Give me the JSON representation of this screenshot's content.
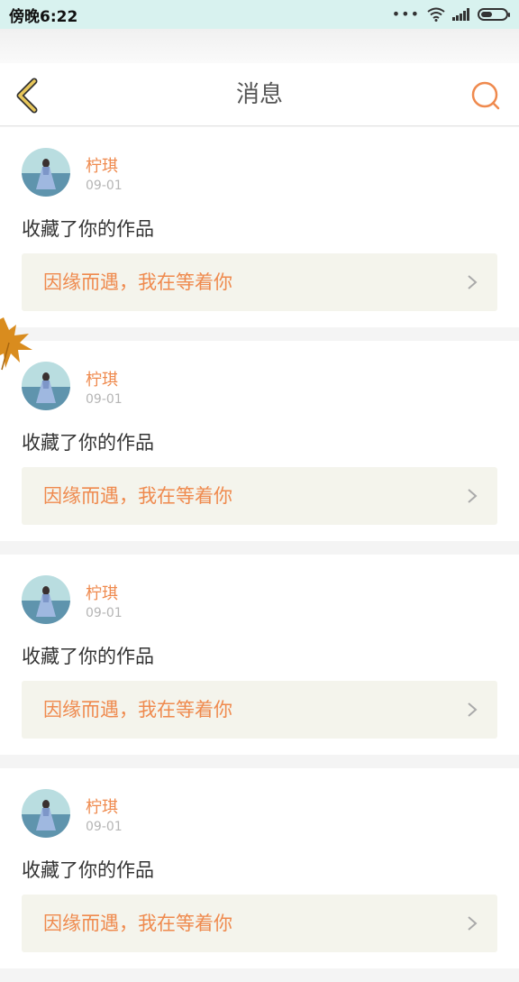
{
  "status_bar": {
    "time": "傍晚6:22",
    "dots": "•••"
  },
  "header": {
    "title": "消息"
  },
  "messages": [
    {
      "user": "柠琪",
      "date": "09-01",
      "action": "收藏了你的作品",
      "work_title": "因缘而遇，我在等着你"
    },
    {
      "user": "柠琪",
      "date": "09-01",
      "action": "收藏了你的作品",
      "work_title": "因缘而遇，我在等着你"
    },
    {
      "user": "柠琪",
      "date": "09-01",
      "action": "收藏了你的作品",
      "work_title": "因缘而遇，我在等着你"
    },
    {
      "user": "柠琪",
      "date": "09-01",
      "action": "收藏了你的作品",
      "work_title": "因缘而遇，我在等着你"
    }
  ],
  "colors": {
    "accent": "#ef8a4e",
    "status_bar": "#d8f2ef",
    "back_icon": "#e8c75a"
  },
  "icons": [
    "back-chevron-icon",
    "search-icon",
    "wifi-icon",
    "signal-icon",
    "battery-icon",
    "chevron-right-icon",
    "maple-leaf-icon"
  ]
}
